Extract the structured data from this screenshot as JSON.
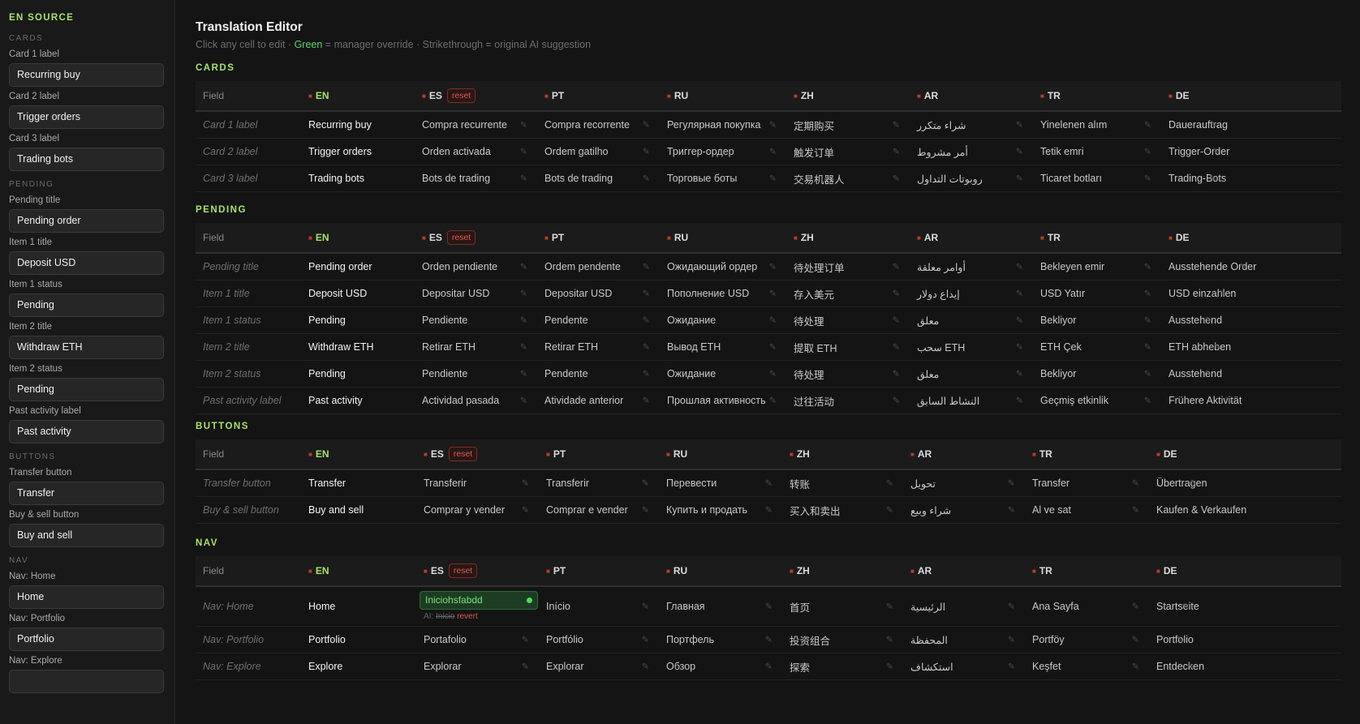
{
  "sidebar": {
    "heading": "EN SOURCE",
    "groups": [
      {
        "title": "CARDS",
        "fields": [
          {
            "label": "Card 1 label",
            "value": "Recurring buy"
          },
          {
            "label": "Card 2 label",
            "value": "Trigger orders"
          },
          {
            "label": "Card 3 label",
            "value": "Trading bots"
          }
        ]
      },
      {
        "title": "PENDING",
        "fields": [
          {
            "label": "Pending title",
            "value": "Pending order"
          },
          {
            "label": "Item 1 title",
            "value": "Deposit USD"
          },
          {
            "label": "Item 1 status",
            "value": "Pending"
          },
          {
            "label": "Item 2 title",
            "value": "Withdraw ETH"
          },
          {
            "label": "Item 2 status",
            "value": "Pending"
          },
          {
            "label": "Past activity label",
            "value": "Past activity"
          }
        ]
      },
      {
        "title": "BUTTONS",
        "fields": [
          {
            "label": "Transfer button",
            "value": "Transfer"
          },
          {
            "label": "Buy & sell button",
            "value": "Buy and sell"
          }
        ]
      },
      {
        "title": "NAV",
        "fields": [
          {
            "label": "Nav: Home",
            "value": "Home"
          },
          {
            "label": "Nav: Portfolio",
            "value": "Portfolio"
          },
          {
            "label": "Nav: Explore",
            "value": ""
          }
        ]
      }
    ]
  },
  "editor": {
    "title": "Translation Editor",
    "subtitle_pre": "Click any cell to edit · ",
    "subtitle_green": "Green",
    "subtitle_mid": " = manager override · Strikethrough = original AI suggestion"
  },
  "table_header": {
    "field": "Field",
    "reset": "reset",
    "languages": [
      {
        "code": "EN",
        "flag": "us-flag-icon"
      },
      {
        "code": "ES",
        "flag": "es-flag-icon"
      },
      {
        "code": "PT",
        "flag": "br-flag-icon"
      },
      {
        "code": "RU",
        "flag": "ru-flag-icon"
      },
      {
        "code": "ZH",
        "flag": "cn-flag-icon"
      },
      {
        "code": "AR",
        "flag": "sa-flag-icon"
      },
      {
        "code": "TR",
        "flag": "tr-flag-icon"
      },
      {
        "code": "DE",
        "flag": "de-flag-icon"
      }
    ]
  },
  "sections": [
    {
      "title": "CARDS",
      "rows": [
        {
          "field": "Card 1 label",
          "values": [
            "Recurring buy",
            "Compra recurrente",
            "Compra recorrente",
            "Регулярная покупка",
            "定期购买",
            "شراء متكرر",
            "Yinelenen alım",
            "Dauerauftrag"
          ]
        },
        {
          "field": "Card 2 label",
          "values": [
            "Trigger orders",
            "Orden activada",
            "Ordem gatilho",
            "Триггер-ордер",
            "触发订单",
            "أمر مشروط",
            "Tetik emri",
            "Trigger-Order"
          ]
        },
        {
          "field": "Card 3 label",
          "values": [
            "Trading bots",
            "Bots de trading",
            "Bots de trading",
            "Торговые боты",
            "交易机器人",
            "روبوتات التداول",
            "Ticaret botları",
            "Trading-Bots"
          ]
        }
      ]
    },
    {
      "title": "PENDING",
      "rows": [
        {
          "field": "Pending title",
          "values": [
            "Pending order",
            "Orden pendiente",
            "Ordem pendente",
            "Ожидающий ордер",
            "待处理订单",
            "أوامر معلقة",
            "Bekleyen emir",
            "Ausstehende Order"
          ]
        },
        {
          "field": "Item 1 title",
          "values": [
            "Deposit USD",
            "Depositar USD",
            "Depositar USD",
            "Пополнение USD",
            "存入美元",
            "إيداع دولار",
            "USD Yatır",
            "USD einzahlen"
          ]
        },
        {
          "field": "Item 1 status",
          "values": [
            "Pending",
            "Pendiente",
            "Pendente",
            "Ожидание",
            "待处理",
            "معلق",
            "Bekliyor",
            "Ausstehend"
          ]
        },
        {
          "field": "Item 2 title",
          "values": [
            "Withdraw ETH",
            "Retirar ETH",
            "Retirar ETH",
            "Вывод ETH",
            "提取 ETH",
            "سحب ETH",
            "ETH Çek",
            "ETH abheben"
          ]
        },
        {
          "field": "Item 2 status",
          "values": [
            "Pending",
            "Pendiente",
            "Pendente",
            "Ожидание",
            "待处理",
            "معلق",
            "Bekliyor",
            "Ausstehend"
          ]
        },
        {
          "field": "Past activity label",
          "values": [
            "Past activity",
            "Actividad pasada",
            "Atividade anterior",
            "Прошлая активность",
            "过往活动",
            "النشاط السابق",
            "Geçmiş etkinlik",
            "Frühere Aktivität"
          ]
        }
      ]
    },
    {
      "title": "BUTTONS",
      "rows": [
        {
          "field": "Transfer button",
          "values": [
            "Transfer",
            "Transferir",
            "Transferir",
            "Перевести",
            "转账",
            "تحويل",
            "Transfer",
            "Übertragen"
          ]
        },
        {
          "field": "Buy and sell button",
          "display_field": "Buy & sell button",
          "values": [
            "Buy and sell",
            "Comprar y vender",
            "Comprar e vender",
            "Купить и продать",
            "买入和卖出",
            "شراء وبيع",
            "Al ve sat",
            "Kaufen & Verkaufen"
          ]
        }
      ]
    },
    {
      "title": "NAV",
      "rows": [
        {
          "field": "Nav: Home",
          "values": [
            "Home",
            "Iniciohsfabdd",
            "Início",
            "Главная",
            "首页",
            "الرئيسية",
            "Ana Sayfa",
            "Startseite"
          ],
          "override": {
            "col": 1,
            "value": "Iniciohsfabdd",
            "ai_prefix": "AI:",
            "ai_original": "Inicio",
            "revert": "revert"
          }
        },
        {
          "field": "Nav: Portfolio",
          "values": [
            "Portfolio",
            "Portafolio",
            "Portfólio",
            "Портфель",
            "投资组合",
            "المحفظة",
            "Portföy",
            "Portfolio"
          ]
        },
        {
          "field": "Nav: Explore",
          "values": [
            "Explore",
            "Explorar",
            "Explorar",
            "Обзор",
            "探索",
            "استكشاف",
            "Keşfet",
            "Entdecken"
          ]
        }
      ]
    }
  ],
  "icons": {
    "edit": "pencil-icon",
    "override_indicator": "status-dot-icon"
  },
  "colors": {
    "accent_green": "#a6e36a",
    "override_green": "#5fd36a",
    "reset_red": "#e05a47"
  }
}
